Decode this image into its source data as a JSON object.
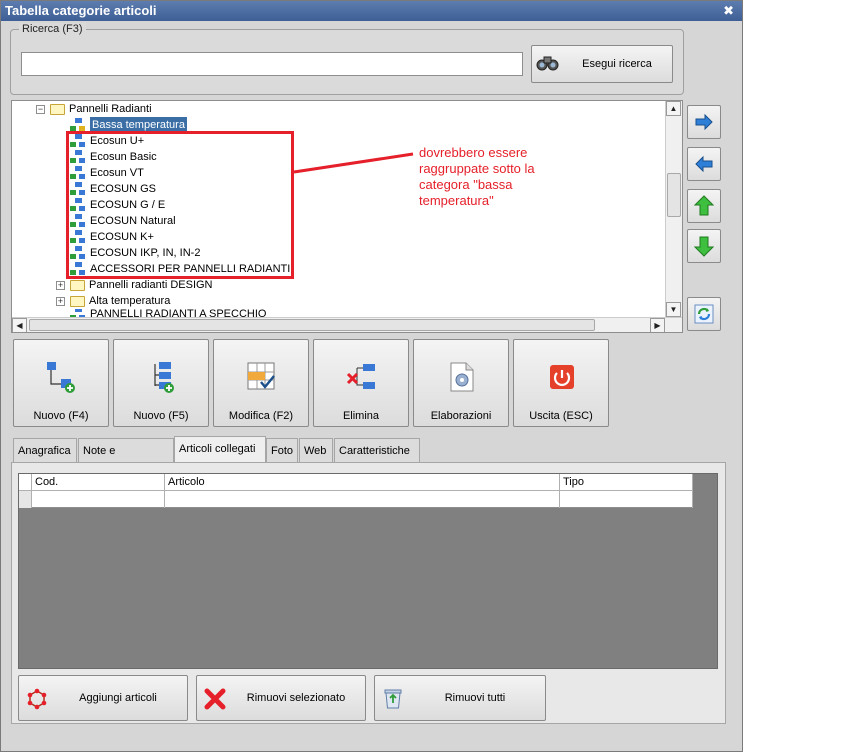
{
  "window": {
    "title": "Tabella categorie articoli",
    "close_glyph": "✖"
  },
  "search": {
    "group_label": "Ricerca (F3)",
    "input_value": "",
    "button_label": "Esegui ricerca",
    "button_icon": "binoculars-icon"
  },
  "tree": {
    "nodes": [
      {
        "label": "Pannelli Radianti",
        "kind": "folder",
        "expander": "−"
      },
      {
        "label": "Bassa temperatura",
        "kind": "category",
        "selected": true
      },
      {
        "label": "Ecosun U+",
        "kind": "category"
      },
      {
        "label": "Ecosun Basic",
        "kind": "category"
      },
      {
        "label": "Ecosun VT",
        "kind": "category"
      },
      {
        "label": "ECOSUN GS",
        "kind": "category"
      },
      {
        "label": "ECOSUN G / E",
        "kind": "category"
      },
      {
        "label": "ECOSUN Natural",
        "kind": "category"
      },
      {
        "label": "ECOSUN K+",
        "kind": "category"
      },
      {
        "label": "ECOSUN IKP, IN, IN-2",
        "kind": "category"
      },
      {
        "label": "ACCESSORI PER PANNELLI RADIANTI",
        "kind": "category"
      },
      {
        "label": "Pannelli radianti DESIGN",
        "kind": "folder",
        "expander": "+"
      },
      {
        "label": "Alta temperatura",
        "kind": "folder",
        "expander": "+"
      },
      {
        "label": "PANNELLI RADIANTI A SPECCHIO",
        "kind": "category"
      }
    ]
  },
  "annotation": {
    "text": "dovrebbero essere raggruppate sotto la categora \"bassa temperatura\"",
    "color": "#e5202a"
  },
  "side_buttons": [
    {
      "name": "move-right-button",
      "icon": "arrow-right-icon"
    },
    {
      "name": "move-left-button",
      "icon": "arrow-left-icon"
    },
    {
      "name": "move-up-button",
      "icon": "arrow-up-icon"
    },
    {
      "name": "move-down-button",
      "icon": "arrow-down-icon"
    },
    {
      "name": "refresh-button",
      "icon": "refresh-icon"
    }
  ],
  "toolbar": {
    "new_f4": "Nuovo (F4)",
    "new_f5": "Nuovo (F5)",
    "edit": "Modifica (F2)",
    "delete": "Elimina",
    "processing": "Elaborazioni",
    "exit": "Uscita (ESC)"
  },
  "tabs": [
    {
      "label": "Anagrafica",
      "active": false
    },
    {
      "label": "Note e descrizioni",
      "active": false
    },
    {
      "label": "Articoli collegati",
      "active": true
    },
    {
      "label": "Foto",
      "active": false
    },
    {
      "label": "Web",
      "active": false
    },
    {
      "label": "Caratteristiche",
      "active": false
    }
  ],
  "grid": {
    "columns": [
      "Cod.",
      "Articolo",
      "Tipo"
    ],
    "rows": [
      [
        "",
        "",
        ""
      ]
    ]
  },
  "bottom_buttons": {
    "add": "Aggiungi articoli",
    "remove_selected": "Rimuovi selezionato",
    "remove_all": "Rimuovi tutti"
  }
}
